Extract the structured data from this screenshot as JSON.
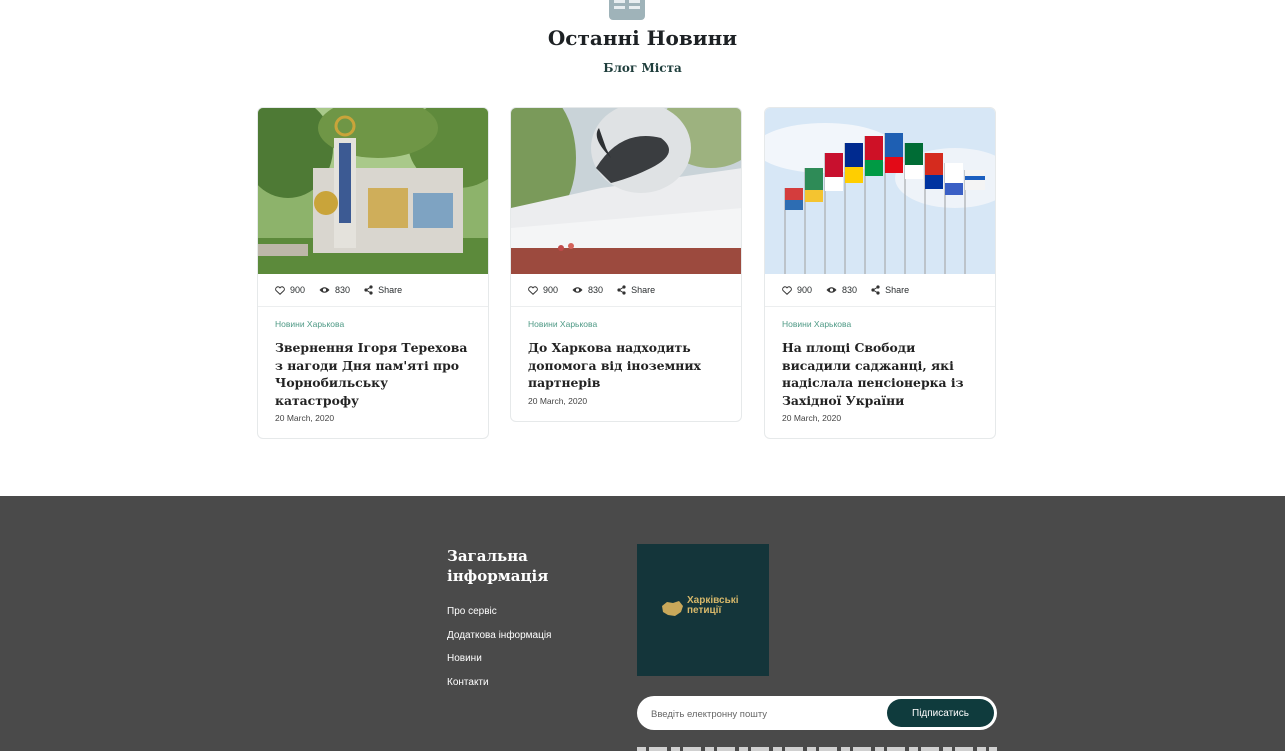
{
  "section": {
    "icon": "newspaper-icon",
    "title": "Останні Новини",
    "subtitle": "Блог Міста"
  },
  "cards": [
    {
      "image": "chernobyl-city-sign",
      "likes": "900",
      "views": "830",
      "share": "Share",
      "category": "Новини Харькова",
      "title": "Звернення Ігоря Терехова з нагоди Дня пам'яті про Чорнобильську катастрофу",
      "date": "20 March, 2020"
    },
    {
      "image": "memorial-monument",
      "likes": "900",
      "views": "830",
      "share": "Share",
      "category": "Новини Харькова",
      "title": "До Харкова надходить допомога від іноземних партнерів",
      "date": "20 March, 2020"
    },
    {
      "image": "international-flags",
      "likes": "900",
      "views": "830",
      "share": "Share",
      "category": "Новини Харькова",
      "title": "На площі Свободи висадили саджанці, які надіслала пенсіонерка із Західної України",
      "date": "20 March, 2020"
    }
  ],
  "footer": {
    "info_title": "Загальна інформація",
    "links": [
      "Про сервіс",
      "Додаткова інформація",
      "Новини",
      "Контакти"
    ],
    "logo_text_line1": "Харківські",
    "logo_text_line2": "петиції",
    "subscribe_placeholder": "Введіть електронну пошту",
    "subscribe_button": "Підписатись"
  },
  "colors": {
    "accent": "#0f3b3d",
    "category": "#4f9a86",
    "footer_bg": "#4a4a4a"
  }
}
